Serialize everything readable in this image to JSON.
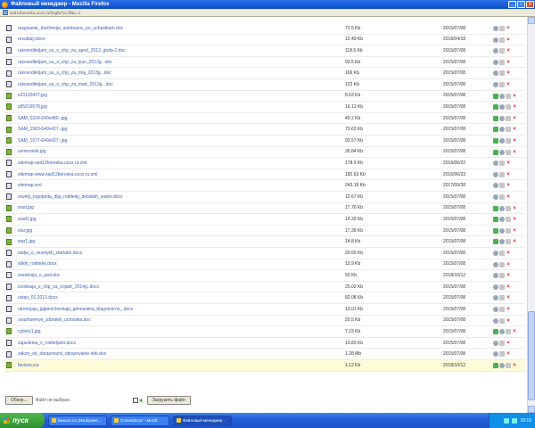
{
  "window": {
    "title": "Файловый менеджер - Mozilla Firefox",
    "url": "sad12bereska.ucoz.ru/fmgfx/?a=fff&c=1"
  },
  "files": [
    {
      "name": "raspisanie_dvizhenija_avtobusov_po_uchastkam.doc",
      "size": "72.5 Kb",
      "date": "2015/07/08",
      "type": "doc"
    },
    {
      "name": "resultaty.docx",
      "size": "12.49 Kb",
      "date": "2018/04/18",
      "type": "doc"
    },
    {
      "name": "rukovoditeljam_ou_o_chp_za_aprel_2012_goda-2.doc",
      "size": "118.5 Kb",
      "date": "2015/07/08",
      "type": "doc"
    },
    {
      "name": "rukovoditeljam_ou_o_chp_za_iyun_2013g...doc",
      "size": "93.5 Kb",
      "date": "2015/07/08",
      "type": "doc"
    },
    {
      "name": "rukovoditeljam_ou_o_chp_za_maj_2013g...doc",
      "size": "166 Kb",
      "date": "2015/07/08",
      "type": "doc"
    },
    {
      "name": "rukovoditeljam_ou_o_chp_za_mart_2013g...doc",
      "size": "122 Kb",
      "date": "2015/07/08",
      "type": "doc"
    },
    {
      "name": "s33120427.jpg",
      "size": "8.63 Kb",
      "date": "2015/07/08",
      "type": "img"
    },
    {
      "name": "s85219578.jpg",
      "size": "16.13 Kb",
      "date": "2015/07/08",
      "type": "img"
    },
    {
      "name": "SAM_0224-640x480-.jpg",
      "size": "49.2 Kb",
      "date": "2015/07/08",
      "type": "img"
    },
    {
      "name": "SAM_1563-640x427-.jpg",
      "size": "73.63 Kb",
      "date": "2015/07/08",
      "type": "img"
    },
    {
      "name": "SAM_1577-640x427-.jpg",
      "size": "93.57 Kb",
      "date": "2015/07/08",
      "type": "img"
    },
    {
      "name": "semicvetik.jpg",
      "size": "30.84 Kb",
      "date": "2015/07/08",
      "type": "img"
    },
    {
      "name": "sitemap-sad12bereska.ucoz.ru.xml",
      "size": "178.9 Kb",
      "date": "2016/06/22",
      "type": "doc"
    },
    {
      "name": "sitemap-www.sad12bereska.ucoz.ru.xml",
      "size": "182.63 Kb",
      "date": "2016/06/23",
      "type": "doc"
    },
    {
      "name": "sitemap.xml",
      "size": "243.18 Kb",
      "date": "2017/09/28",
      "type": "doc"
    },
    {
      "name": "sovety_logopeda_dlja_roditelej_detskikh_sadov.docx",
      "size": "12.67 Kb",
      "date": "2015/07/08",
      "type": "doc"
    },
    {
      "name": "srad.jpg",
      "size": "17.76 Kb",
      "date": "2015/07/08",
      "type": "img"
    },
    {
      "name": "srad1.jpg",
      "size": "14.33 Kb",
      "date": "2015/07/08",
      "type": "img"
    },
    {
      "name": "star.jpg",
      "size": "17.39 Kb",
      "date": "2015/07/08",
      "type": "img"
    },
    {
      "name": "star1.jpg",
      "size": "14.8 Kb",
      "date": "2015/07/08",
      "type": "img"
    },
    {
      "name": "statja_o_veselykh_startakh.docx",
      "size": "20.55 Kb",
      "date": "2015/07/08",
      "type": "doc"
    },
    {
      "name": "stikhi_roditelej.docx",
      "size": "13.9 Kb",
      "date": "2015/07/08",
      "type": "doc"
    },
    {
      "name": "svedenija_o_ped.doc",
      "size": "50 Kb",
      "date": "2018/10/12",
      "type": "doc"
    },
    {
      "name": "svodnaja_o_chp_za_nojabr_2014g..docx",
      "size": "25.02 Kb",
      "date": "2015/07/08",
      "type": "doc"
    },
    {
      "name": "ustav_01.2013.docx",
      "size": "82.08 Kb",
      "date": "2015/07/08",
      "type": "doc"
    },
    {
      "name": "utrennjaja_gigienicheskaja_gimnastika_blagotvorno_.docx",
      "size": "13.01 Kb",
      "date": "2015/07/08",
      "type": "doc"
    },
    {
      "name": "uvazhaemye_izbirateli_uchastka.doc",
      "size": "20.5 Kb",
      "date": "2015/07/08",
      "type": "doc"
    },
    {
      "name": "vybory1.jpg",
      "size": "7.23 Kb",
      "date": "2015/07/08",
      "type": "img"
    },
    {
      "name": "zajavlenia_s_roditeljami.docx",
      "size": "13.83 Kb",
      "date": "2015/07/08",
      "type": "doc"
    },
    {
      "name": "zakon_ob_obrazovanii_obrazovanie-dok.doc",
      "size": "1.28 Mb",
      "date": "2015/07/08",
      "type": "doc"
    },
    {
      "name": "favicon.ico",
      "size": "1.12 Kb",
      "date": "2018/10/12",
      "type": "img",
      "highlight": true
    }
  ],
  "upload": {
    "browse_label": "Обзор...",
    "no_file_label": "Файл не выбран.",
    "upload_label": "Загрузить файл"
  },
  "taskbar": {
    "start_label": "пуск",
    "tasks": [
      "favicon.ico (Изображе...",
      "ConvertIcon! - Mozill...",
      "Файловый менеджер..."
    ],
    "clock": "20:18"
  }
}
